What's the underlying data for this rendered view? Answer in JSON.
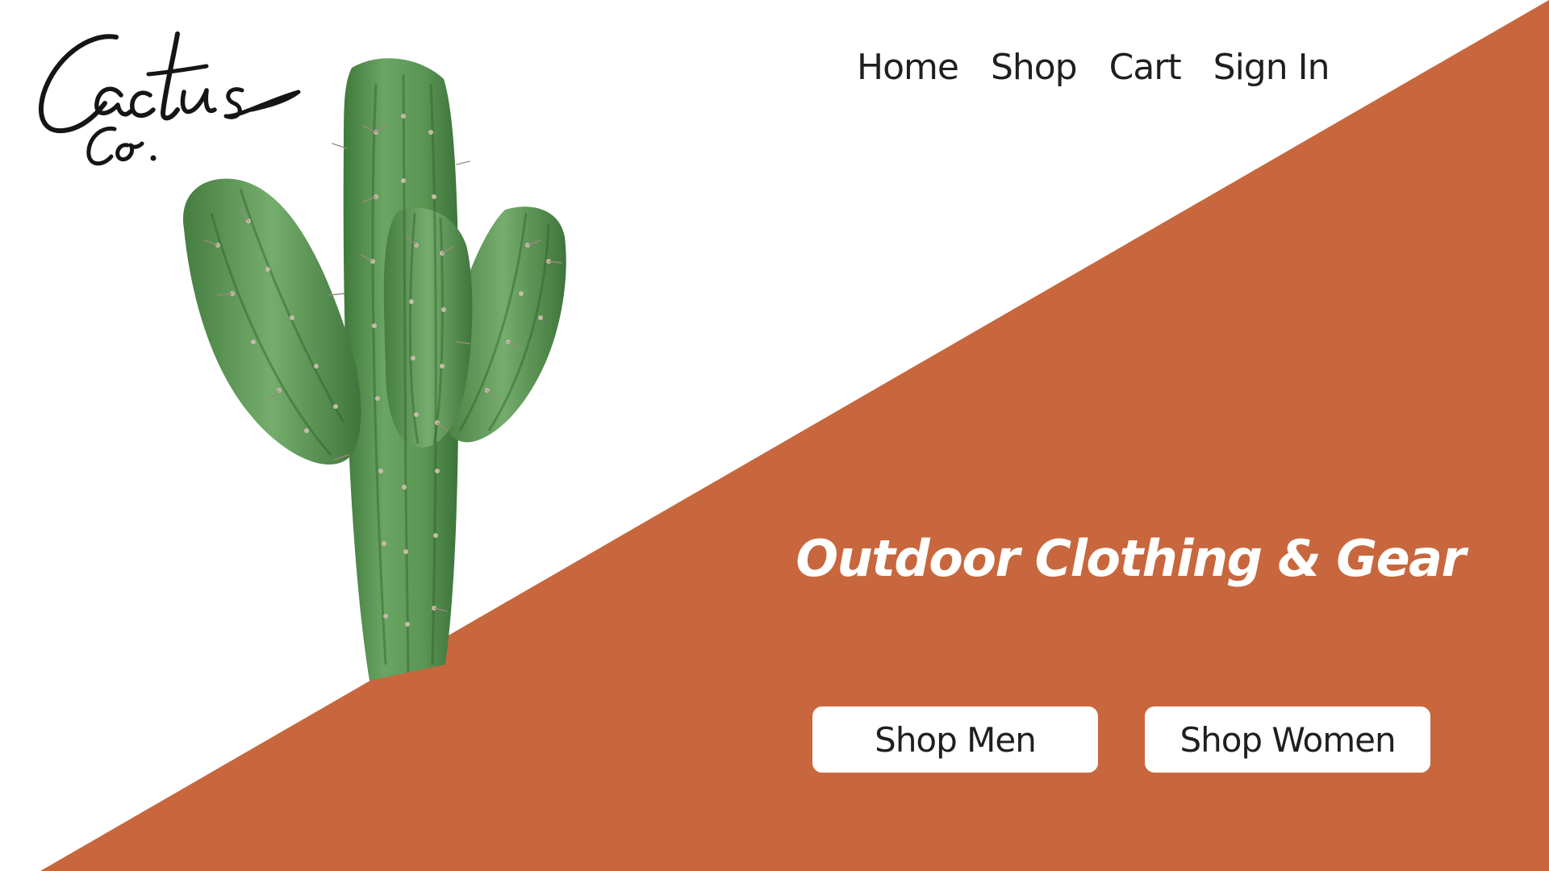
{
  "brand": {
    "logo_text": "Cactus Co.",
    "colors": {
      "accent": "#c8673d",
      "background": "#ffffff",
      "text_dark": "#1f1f1f",
      "cactus_green": "#5f9b58"
    }
  },
  "nav": {
    "items": [
      {
        "label": "Home"
      },
      {
        "label": "Shop"
      },
      {
        "label": "Cart"
      },
      {
        "label": "Sign In"
      }
    ]
  },
  "hero": {
    "headline": "Outdoor Clothing & Gear",
    "buttons": {
      "men": "Shop Men",
      "women": "Shop Women"
    },
    "image": "cactus-image"
  }
}
